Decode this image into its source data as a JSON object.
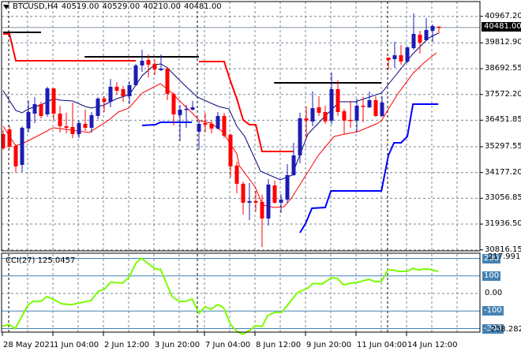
{
  "header": {
    "symbol": "BTCUSD,H4",
    "open": "40519.00",
    "high": "40529.00",
    "low": "40210.00",
    "close": "40481.00"
  },
  "price_scale": {
    "labels": [
      "40967.20",
      "39812.90",
      "38692.55",
      "37572.20",
      "36451.85",
      "35297.55",
      "34177.20",
      "33056.85",
      "31936.50",
      "30816.15"
    ],
    "current_price_label": "40481.00",
    "min": 30816.15,
    "max": 40967.2
  },
  "cci": {
    "title": "CCI(27) 125.0457",
    "max_label": "217.9915",
    "min_label": "-258.2824",
    "levels": [
      "200",
      "100",
      "0.00",
      "-100",
      "-200"
    ],
    "series": [
      [
        -0.1,
        -186
      ],
      [
        1,
        -177
      ],
      [
        1.9,
        -200
      ],
      [
        3.9,
        -68
      ],
      [
        4.75,
        -45
      ],
      [
        6,
        -45
      ],
      [
        6.9,
        -18
      ],
      [
        7.9,
        -32
      ],
      [
        9.25,
        -59
      ],
      [
        10.75,
        -64
      ],
      [
        12,
        -55
      ],
      [
        13.9,
        -41
      ],
      [
        15.1,
        14
      ],
      [
        16,
        23
      ],
      [
        17,
        64
      ],
      [
        18.9,
        59
      ],
      [
        19.9,
        91
      ],
      [
        21.1,
        177
      ],
      [
        21.9,
        200
      ],
      [
        23.9,
        145
      ],
      [
        24.5,
        136
      ],
      [
        24.9,
        139
      ],
      [
        26.75,
        -18
      ],
      [
        27.9,
        -45
      ],
      [
        28.9,
        -45
      ],
      [
        29.9,
        -31
      ],
      [
        31,
        -112
      ],
      [
        32,
        -76
      ],
      [
        32.9,
        -90
      ],
      [
        34,
        -63
      ],
      [
        34.9,
        -81
      ],
      [
        36,
        -175
      ],
      [
        37,
        -215
      ],
      [
        37.9,
        -233
      ],
      [
        39.25,
        -206
      ],
      [
        39.9,
        -184
      ],
      [
        41,
        -188
      ],
      [
        41.9,
        -126
      ],
      [
        43,
        -108
      ],
      [
        44.1,
        -108
      ],
      [
        46.6,
        4
      ],
      [
        48.25,
        31
      ],
      [
        49.1,
        58
      ],
      [
        50.5,
        54
      ],
      [
        52,
        90
      ],
      [
        52.9,
        86
      ],
      [
        53.9,
        49
      ],
      [
        54.9,
        58
      ],
      [
        56.1,
        63
      ],
      [
        57.9,
        81
      ],
      [
        58.9,
        68
      ],
      [
        59.9,
        68
      ],
      [
        60.9,
        134
      ],
      [
        61.75,
        134
      ],
      [
        62.6,
        126
      ],
      [
        63.9,
        126
      ],
      [
        64.9,
        143
      ],
      [
        65.75,
        134
      ],
      [
        66.6,
        139
      ],
      [
        67.4,
        139
      ],
      [
        68.9,
        126
      ]
    ]
  },
  "time_labels": [
    "28 May 2021",
    "1 Jun 04:00",
    "2 Jun 12:00",
    "3 Jun 20:00",
    "7 Jun 04:00",
    "8 Jun 12:00",
    "9 Jun 20:00",
    "11 Jun 04:00",
    "14 Jun 12:00"
  ],
  "colors": {
    "bull": "#1c1cb4",
    "bear": "#ff0000",
    "ma_fast": "#00007a",
    "ma_slow": "#ff0000",
    "stop_upper": "#ff0000",
    "stop_lower": "#0000ff",
    "level": "#000000",
    "cci": "#7cfc00",
    "grid": "#778899",
    "cci_level": "#4682b4"
  },
  "chart_data": {
    "type": "candlestick",
    "title": "BTCUSD,H4",
    "ohlc": [
      [
        35848,
        36019,
        35162,
        35230
      ],
      [
        36053,
        36191,
        35230,
        35299
      ],
      [
        35333,
        35402,
        34167,
        34442
      ],
      [
        34510,
        36191,
        34202,
        36122
      ],
      [
        36088,
        37322,
        35916,
        36808
      ],
      [
        36739,
        37459,
        36328,
        37151
      ],
      [
        37151,
        37254,
        36533,
        36636
      ],
      [
        36705,
        37905,
        36602,
        37837
      ],
      [
        37837,
        37837,
        36465,
        36739
      ],
      [
        36739,
        37082,
        35916,
        36191
      ],
      [
        36191,
        36774,
        35882,
        36122
      ],
      [
        36157,
        37219,
        35676,
        35848
      ],
      [
        35848,
        36431,
        35676,
        36328
      ],
      [
        36294,
        36911,
        35985,
        36122
      ],
      [
        36122,
        36808,
        35916,
        36671
      ],
      [
        36636,
        37459,
        36499,
        37391
      ],
      [
        37391,
        37494,
        36808,
        37254
      ],
      [
        37254,
        38248,
        37014,
        37905
      ],
      [
        37905,
        38111,
        37562,
        37734
      ],
      [
        37802,
        37939,
        37254,
        37494
      ],
      [
        37494,
        38145,
        37151,
        37974
      ],
      [
        37974,
        38899,
        37939,
        38831
      ],
      [
        38831,
        39517,
        38557,
        39037
      ],
      [
        39071,
        39311,
        38317,
        38865
      ],
      [
        38899,
        39071,
        38420,
        38659
      ],
      [
        38625,
        39311,
        38591,
        38694
      ],
      [
        38694,
        38762,
        37322,
        37597
      ],
      [
        37597,
        37665,
        36225,
        36705
      ],
      [
        36671,
        37117,
        35539,
        36911
      ],
      [
        36911,
        37117,
        36122,
        36945
      ],
      [
        36911,
        37288,
        36877,
        37014
      ],
      [
        35950,
        36431,
        35162,
        36294
      ],
      [
        36328,
        36774,
        35916,
        36259
      ],
      [
        36294,
        36431,
        35882,
        36088
      ],
      [
        36088,
        36808,
        36053,
        36636
      ],
      [
        36636,
        36774,
        35676,
        35779
      ],
      [
        35813,
        35882,
        33962,
        34442
      ],
      [
        34476,
        34648,
        33276,
        33688
      ],
      [
        33688,
        33790,
        32350,
        32864
      ],
      [
        32864,
        33722,
        32110,
        32933
      ],
      [
        32933,
        33379,
        32487,
        32864
      ],
      [
        32899,
        33207,
        30944,
        32179
      ],
      [
        32179,
        33893,
        31870,
        33653
      ],
      [
        33619,
        33825,
        32830,
        32864
      ],
      [
        32864,
        33242,
        32419,
        33002
      ],
      [
        33002,
        34545,
        32864,
        34065
      ],
      [
        34065,
        35470,
        34030,
        34922
      ],
      [
        34922,
        36774,
        34579,
        36533
      ],
      [
        36533,
        37048,
        35607,
        36431
      ],
      [
        36396,
        37699,
        36191,
        36979
      ],
      [
        37014,
        37494,
        36636,
        36774
      ],
      [
        36808,
        37082,
        36294,
        36396
      ],
      [
        36431,
        38522,
        36259,
        37802
      ],
      [
        37802,
        38179,
        36636,
        36808
      ],
      [
        36843,
        36945,
        35848,
        36431
      ],
      [
        36465,
        37288,
        36122,
        36431
      ],
      [
        36431,
        37391,
        35950,
        37082
      ],
      [
        37082,
        37459,
        36362,
        37048
      ],
      [
        37014,
        37699,
        36979,
        37322
      ],
      [
        37322,
        37494,
        36602,
        36636
      ],
      [
        36636,
        37494,
        36602,
        37219
      ],
      [
        39174,
        39174,
        38659,
        39071
      ],
      [
        39105,
        39860,
        38728,
        39277
      ],
      [
        39277,
        39723,
        38865,
        39002
      ],
      [
        39002,
        39654,
        38934,
        39620
      ],
      [
        39586,
        41094,
        39517,
        40203
      ],
      [
        40168,
        40340,
        39345,
        39825
      ],
      [
        39928,
        40888,
        39894,
        40374
      ],
      [
        40340,
        40614,
        39860,
        40545
      ],
      [
        40519,
        40529,
        40210,
        40481
      ]
    ],
    "ma_fast": [
      [
        0,
        37734
      ],
      [
        2,
        36877
      ],
      [
        3,
        36774
      ],
      [
        4,
        36945
      ],
      [
        6,
        37117
      ],
      [
        8,
        37391
      ],
      [
        9,
        37322
      ],
      [
        11,
        37288
      ],
      [
        13,
        37048
      ],
      [
        14,
        36979
      ],
      [
        16,
        37117
      ],
      [
        18,
        37391
      ],
      [
        20,
        37562
      ],
      [
        21,
        37974
      ],
      [
        22,
        38385
      ],
      [
        24,
        38865
      ],
      [
        25,
        38899
      ],
      [
        26,
        38728
      ],
      [
        28.6,
        38008
      ],
      [
        30.75,
        37459
      ],
      [
        34.1,
        37048
      ],
      [
        35.75,
        36945
      ],
      [
        37,
        36191
      ],
      [
        38.25,
        35745
      ],
      [
        40.75,
        34236
      ],
      [
        43.9,
        33859
      ],
      [
        45.75,
        34065
      ],
      [
        48.25,
        35848
      ],
      [
        50.4,
        36465
      ],
      [
        53.25,
        37254
      ],
      [
        55.75,
        37254
      ],
      [
        59.9,
        37631
      ],
      [
        62.4,
        38488
      ],
      [
        64.9,
        39345
      ],
      [
        67.4,
        40031
      ],
      [
        68.9,
        40237
      ]
    ],
    "ma_slow": [
      [
        0,
        36191
      ],
      [
        2,
        35333
      ],
      [
        3.6,
        35505
      ],
      [
        7.9,
        36122
      ],
      [
        9.1,
        36088
      ],
      [
        13.6,
        35916
      ],
      [
        16.6,
        36431
      ],
      [
        18.25,
        36808
      ],
      [
        19.9,
        36979
      ],
      [
        22,
        37631
      ],
      [
        24.9,
        38042
      ],
      [
        26.6,
        37665
      ],
      [
        28.6,
        37117
      ],
      [
        29.9,
        36774
      ],
      [
        31.1,
        36431
      ],
      [
        32.9,
        36328
      ],
      [
        34.75,
        35950
      ],
      [
        37,
        34990
      ],
      [
        37.4,
        34476
      ],
      [
        39.9,
        33550
      ],
      [
        41.1,
        32762
      ],
      [
        42.9,
        32659
      ],
      [
        44.5,
        32693
      ],
      [
        45.75,
        33105
      ],
      [
        49.9,
        34922
      ],
      [
        52.4,
        35745
      ],
      [
        54.1,
        35848
      ],
      [
        56.1,
        35950
      ],
      [
        59.1,
        36294
      ],
      [
        59.9,
        36431
      ],
      [
        61.1,
        36979
      ],
      [
        62.4,
        37562
      ],
      [
        64.9,
        38488
      ],
      [
        66.6,
        38934
      ],
      [
        68.6,
        39380
      ]
    ],
    "stop_upper": [
      [
        [
          0,
          40203
        ],
        [
          1,
          40203
        ],
        [
          2,
          39037
        ],
        [
          21,
          39037
        ]
      ],
      [
        [
          31,
          39003
        ],
        [
          35,
          39003
        ],
        [
          36,
          38145
        ],
        [
          37,
          37391
        ],
        [
          38,
          36465
        ],
        [
          39,
          36259
        ],
        [
          40,
          36259
        ],
        [
          41,
          35093
        ],
        [
          46,
          35093
        ]
      ]
    ],
    "stop_lower": [
      [
        [
          22,
          36225
        ],
        [
          24.1,
          36259
        ],
        [
          24.9,
          36362
        ],
        [
          29.9,
          36362
        ]
      ],
      [
        [
          47,
          31561
        ],
        [
          47.9,
          31973
        ],
        [
          48.9,
          32624
        ],
        [
          51,
          32659
        ],
        [
          51.9,
          33379
        ],
        [
          59.9,
          33379
        ],
        [
          61,
          34922
        ],
        [
          61.9,
          35470
        ],
        [
          63,
          35470
        ],
        [
          64,
          35745
        ],
        [
          64.9,
          37151
        ],
        [
          68.9,
          37151
        ]
      ]
    ],
    "levels": [
      [
        0,
        6,
        40271
      ],
      [
        12.9,
        31,
        39208
      ],
      [
        42.9,
        59.9,
        38077
      ]
    ]
  }
}
